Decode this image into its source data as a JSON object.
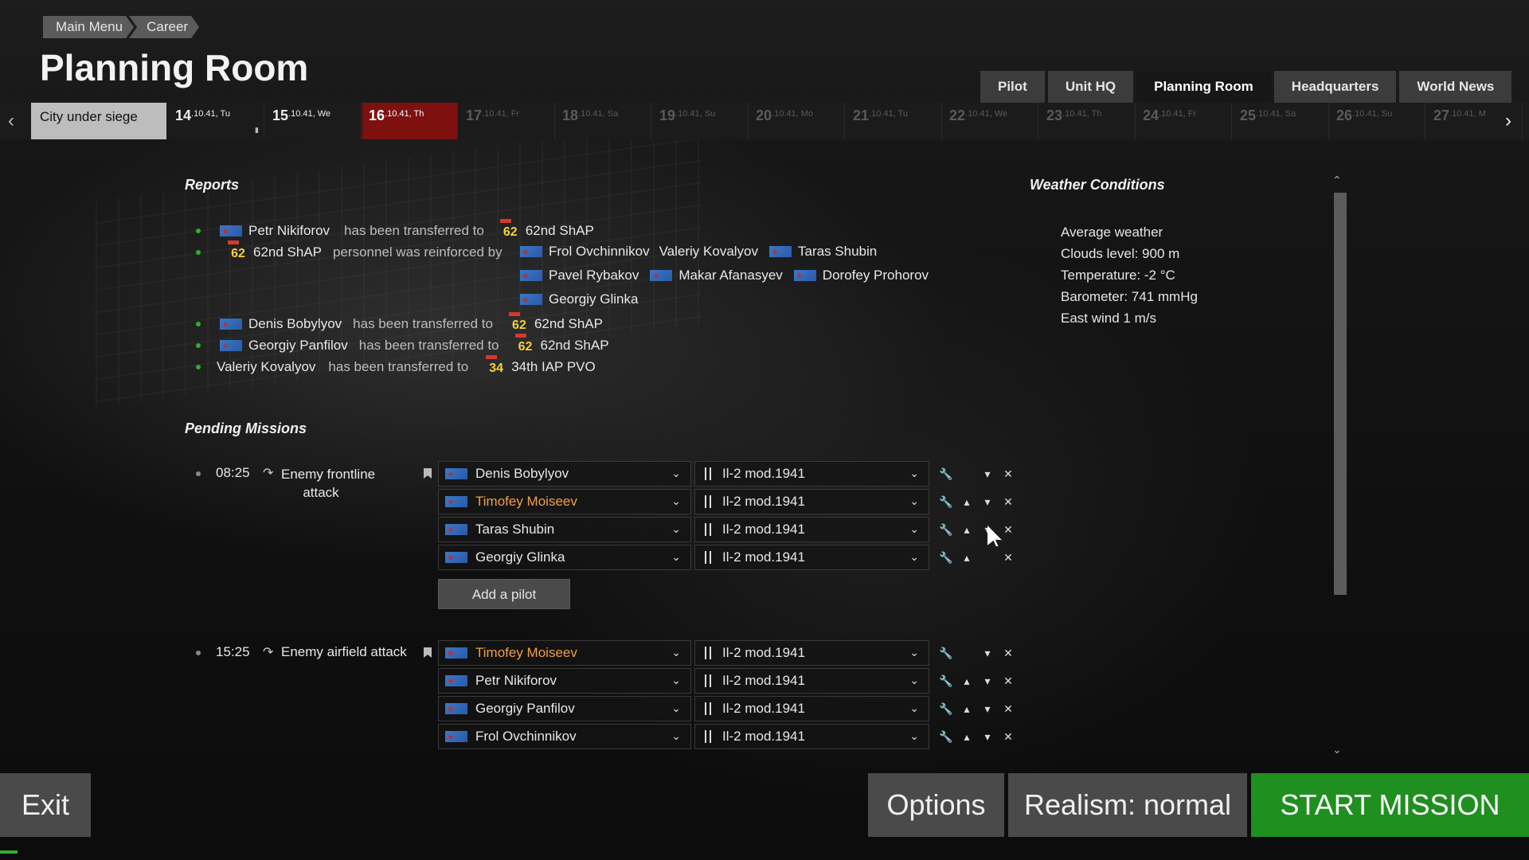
{
  "breadcrumb": [
    "Main Menu",
    "Career"
  ],
  "page_title": "Planning Room",
  "tabs": [
    {
      "label": "Pilot",
      "active": false
    },
    {
      "label": "Unit HQ",
      "active": false
    },
    {
      "label": "Planning Room",
      "active": true
    },
    {
      "label": "Headquarters",
      "active": false
    },
    {
      "label": "World News",
      "active": false
    }
  ],
  "campaign_label": "City under siege",
  "days": [
    {
      "num": "14",
      "suffix": ".10.41, Tu"
    },
    {
      "num": "15",
      "suffix": ".10.41, We"
    },
    {
      "num": "16",
      "suffix": ".10.41, Th"
    },
    {
      "num": "17",
      "suffix": ".10.41, Fr"
    },
    {
      "num": "18",
      "suffix": ".10.41, Sa"
    },
    {
      "num": "19",
      "suffix": ".10.41, Su"
    },
    {
      "num": "20",
      "suffix": ".10.41, Mo"
    },
    {
      "num": "21",
      "suffix": ".10.41, Tu"
    },
    {
      "num": "22",
      "suffix": ".10.41, We"
    },
    {
      "num": "23",
      "suffix": ".10.41, Th"
    },
    {
      "num": "24",
      "suffix": ".10.41, Fr"
    },
    {
      "num": "25",
      "suffix": ".10.41, Sa"
    },
    {
      "num": "26",
      "suffix": ".10.41, Su"
    },
    {
      "num": "27",
      "suffix": ".10.41, M"
    }
  ],
  "reports": {
    "title": "Reports",
    "lines": [
      {
        "a": "Petr Nikiforov",
        "verb": "has been transferred to",
        "unit_num": "62",
        "unit": "62nd ShAP"
      },
      {
        "unit_num": "62",
        "unit": "62nd ShAP",
        "verb": "personnel was reinforced by",
        "names": [
          "Frol Ovchinnikov",
          "Valeriy Kovalyov",
          "Taras Shubin",
          "Pavel Rybakov",
          "Makar Afanasyev",
          "Dorofey Prohorov",
          "Georgiy Glinka"
        ]
      },
      {
        "a": "Denis Bobylyov",
        "verb": "has been transferred to",
        "unit_num": "62",
        "unit": "62nd ShAP"
      },
      {
        "a": "Georgiy Panfilov",
        "verb": "has been transferred to",
        "unit_num": "62",
        "unit": "62nd ShAP"
      },
      {
        "a": "Valeriy Kovalyov",
        "verb": "has been transferred to",
        "unit_num": "34",
        "unit": "34th IAP PVO"
      }
    ]
  },
  "pending": {
    "title": "Pending Missions",
    "missions": [
      {
        "time": "08:25",
        "name_line1": "Enemy frontline",
        "name_line2": "attack",
        "rows": [
          {
            "pilot": "Denis Bobylyov",
            "plane": "Il-2 mod.1941"
          },
          {
            "pilot": "Timofey Moiseev",
            "plane": "Il-2 mod.1941"
          },
          {
            "pilot": "Taras Shubin",
            "plane": "Il-2 mod.1941"
          },
          {
            "pilot": "Georgiy Glinka",
            "plane": "Il-2 mod.1941"
          }
        ],
        "add_label": "Add a pilot"
      },
      {
        "time": "15:25",
        "name_line1": "Enemy airfield attack",
        "name_line2": "",
        "rows": [
          {
            "pilot": "Timofey Moiseev",
            "plane": "Il-2 mod.1941"
          },
          {
            "pilot": "Petr Nikiforov",
            "plane": "Il-2 mod.1941"
          },
          {
            "pilot": "Georgiy Panfilov",
            "plane": "Il-2 mod.1941"
          },
          {
            "pilot": "Frol Ovchinnikov",
            "plane": "Il-2 mod.1941"
          }
        ]
      }
    ]
  },
  "weather": {
    "title": "Weather Conditions",
    "avg": "Average weather",
    "clouds": "Clouds level: 900 m",
    "temp": "Temperature: -2 °C",
    "baro": "Barometer: 741 mmHg",
    "wind": "East wind 1 m/s"
  },
  "buttons": {
    "exit": "Exit",
    "options": "Options",
    "realism": "Realism: normal",
    "start": "START MISSION"
  },
  "colors": {
    "current_day": "#7f1010",
    "start_button": "#1f8f1f",
    "highlight_pilot": "#f0a040",
    "report_bullet": "#2fae2f"
  }
}
